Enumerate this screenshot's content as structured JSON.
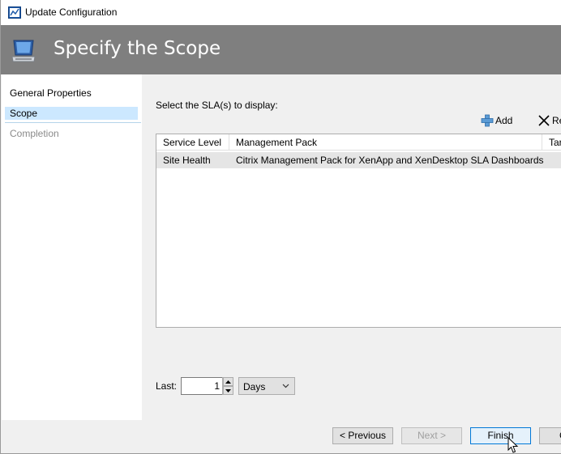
{
  "window": {
    "title": "Update Configuration"
  },
  "banner": {
    "title": "Specify the Scope"
  },
  "nav": {
    "items": [
      {
        "label": "General Properties",
        "state": "normal"
      },
      {
        "label": "Scope",
        "state": "selected"
      },
      {
        "label": "Completion",
        "state": "disabled"
      }
    ]
  },
  "content": {
    "select_label": "Select the SLA(s) to display:",
    "toolbar": {
      "add_label": "Add",
      "remove_label": "Re"
    },
    "grid": {
      "columns": [
        "Service Level",
        "Management Pack",
        "Tar"
      ],
      "rows": [
        [
          "Site Health",
          "Citrix Management Pack for XenApp and XenDesktop SLA Dashboards",
          ""
        ]
      ]
    },
    "last": {
      "label": "Last:",
      "value": "1",
      "unit": "Days"
    }
  },
  "footer": {
    "previous_label": "< Previous",
    "next_label": "Next >",
    "finish_label": "Finish",
    "cancel_label": "C"
  },
  "colors": {
    "banner": "#7f7f7f",
    "selected_nav": "#cce8ff",
    "primary_border": "#0078d7"
  }
}
